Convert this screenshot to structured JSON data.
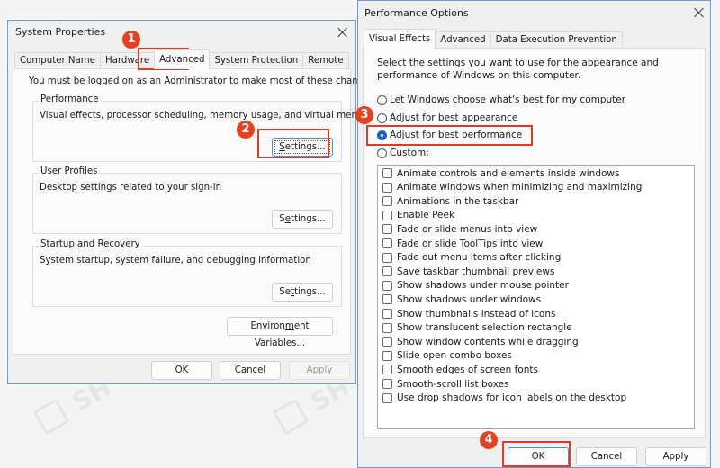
{
  "system_properties": {
    "title": "System Properties",
    "tabs": [
      "Computer Name",
      "Hardware",
      "Advanced",
      "System Protection",
      "Remote"
    ],
    "active_tab": "Advanced",
    "admin_notice": "You must be logged on as an Administrator to make most of these changes.",
    "groups": [
      {
        "label": "Performance",
        "description": "Visual effects, processor scheduling, memory usage, and virtual memory",
        "button": {
          "pre": "",
          "u": "S",
          "post": "ettings..."
        }
      },
      {
        "label": "User Profiles",
        "description": "Desktop settings related to your sign-in",
        "button": {
          "pre": "S",
          "u": "e",
          "post": "ttings..."
        }
      },
      {
        "label": "Startup and Recovery",
        "description": "System startup, system failure, and debugging information",
        "button": {
          "pre": "Se",
          "u": "t",
          "post": "tings..."
        }
      }
    ],
    "env_button": {
      "pre": "Environ",
      "u": "m",
      "post": "ent Variables..."
    },
    "footer": {
      "ok": "OK",
      "cancel": "Cancel",
      "apply_pre": "",
      "apply_u": "A",
      "apply_post": "pply"
    }
  },
  "performance_options": {
    "title": "Performance Options",
    "tabs": [
      "Visual Effects",
      "Advanced",
      "Data Execution Prevention"
    ],
    "active_tab": "Visual Effects",
    "intro": [
      "Select the settings you want to use for the appearance and",
      "performance of Windows on this computer."
    ],
    "radios": [
      {
        "label": "Let Windows choose what's best for my computer",
        "checked": false
      },
      {
        "label": "Adjust for best appearance",
        "checked": false
      },
      {
        "label": "Adjust for best performance",
        "checked": true
      },
      {
        "label": "Custom:",
        "checked": false
      }
    ],
    "checkboxes": [
      {
        "label": "Animate controls and elements inside windows",
        "checked": false
      },
      {
        "label": "Animate windows when minimizing and maximizing",
        "checked": false
      },
      {
        "label": "Animations in the taskbar",
        "checked": false
      },
      {
        "label": "Enable Peek",
        "checked": false
      },
      {
        "label": "Fade or slide menus into view",
        "checked": false
      },
      {
        "label": "Fade or slide ToolTips into view",
        "checked": false
      },
      {
        "label": "Fade out menu items after clicking",
        "checked": false
      },
      {
        "label": "Save taskbar thumbnail previews",
        "checked": false
      },
      {
        "label": "Show shadows under mouse pointer",
        "checked": false
      },
      {
        "label": "Show shadows under windows",
        "checked": false
      },
      {
        "label": "Show thumbnails instead of icons",
        "checked": false
      },
      {
        "label": "Show translucent selection rectangle",
        "checked": false
      },
      {
        "label": "Show window contents while dragging",
        "checked": false
      },
      {
        "label": "Slide open combo boxes",
        "checked": false
      },
      {
        "label": "Smooth edges of screen fonts",
        "checked": false
      },
      {
        "label": "Smooth-scroll list boxes",
        "checked": false
      },
      {
        "label": "Use drop shadows for icon labels on the desktop",
        "checked": false
      }
    ],
    "footer": {
      "ok": "OK",
      "cancel": "Cancel",
      "apply": "Apply"
    }
  },
  "annotations": {
    "step_labels": [
      "1",
      "2",
      "3",
      "4"
    ],
    "highlight_color": "#e53a22",
    "badge_color": "#e8401f"
  },
  "watermark": {
    "text": "SH"
  }
}
